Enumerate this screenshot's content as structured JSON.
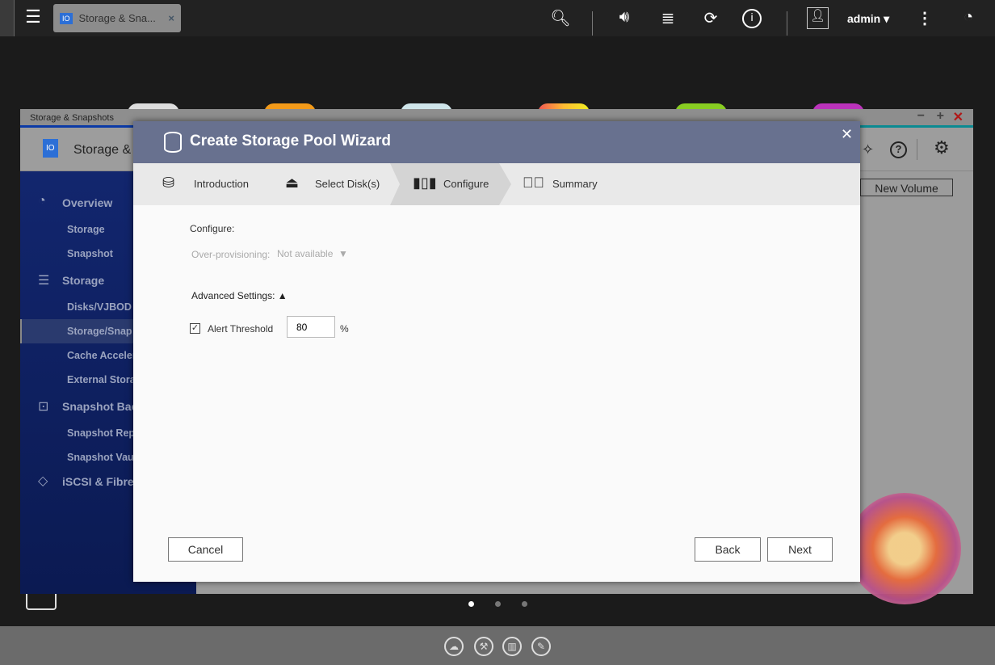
{
  "topbar": {
    "tab_title": "Storage & Sna...",
    "user": "admin"
  },
  "app": {
    "window_title": "Storage & Snapshots",
    "header_title": "Storage &",
    "new_volume": "New Volume",
    "sidebar": [
      {
        "label": "Overview",
        "type": "main",
        "icon": "gauge-icon"
      },
      {
        "label": "Storage",
        "type": "sub"
      },
      {
        "label": "Snapshot",
        "type": "sub"
      },
      {
        "label": "Storage",
        "type": "main",
        "icon": "database-icon"
      },
      {
        "label": "Disks/VJBOD",
        "type": "sub"
      },
      {
        "label": "Storage/Snap",
        "type": "sub",
        "selected": true
      },
      {
        "label": "Cache Acceler",
        "type": "sub"
      },
      {
        "label": "External Stora",
        "type": "sub"
      },
      {
        "label": "Snapshot Bac",
        "type": "main",
        "icon": "camera-icon"
      },
      {
        "label": "Snapshot Rep",
        "type": "sub"
      },
      {
        "label": "Snapshot Vau",
        "type": "sub"
      },
      {
        "label": "iSCSI & Fibre C",
        "type": "main",
        "icon": "iscsi-icon"
      }
    ]
  },
  "wizard": {
    "title": "Create Storage Pool Wizard",
    "steps": [
      "Introduction",
      "Select Disk(s)",
      "Configure",
      "Summary"
    ],
    "active_step": 2,
    "configure_label": "Configure:",
    "overprov_label": "Over-provisioning:",
    "overprov_value": "Not available",
    "advanced_label": "Advanced Settings:",
    "alert_label": "Alert Threshold",
    "alert_value": "80",
    "alert_unit": "%",
    "alert_checked": true,
    "cancel": "Cancel",
    "back": "Back",
    "next": "Next"
  }
}
